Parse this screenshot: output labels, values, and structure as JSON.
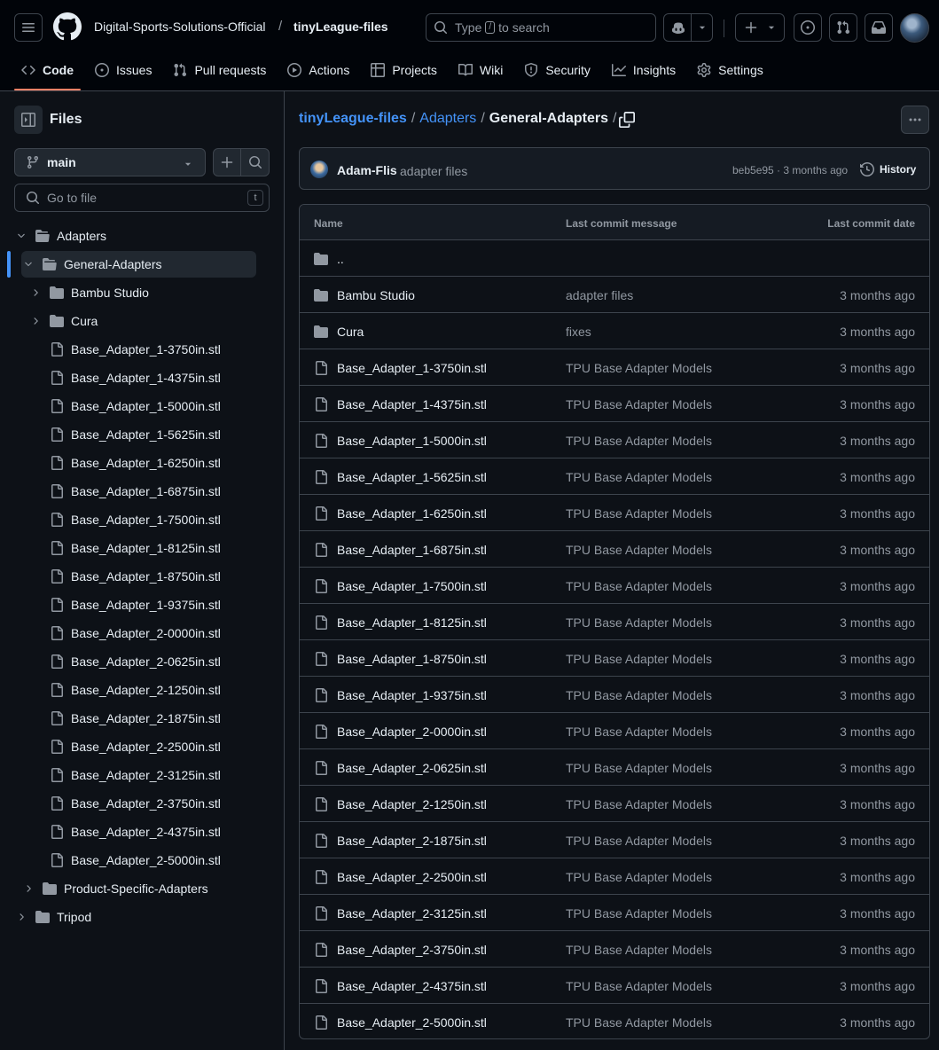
{
  "header": {
    "owner": "Digital-Sports-Solutions-Official",
    "separator": "/",
    "repo": "tinyLeague-files",
    "search_prefix": "Type",
    "search_key": "/",
    "search_suffix": "to search"
  },
  "tabs": [
    {
      "label": "Code",
      "icon": "code-icon",
      "active": true
    },
    {
      "label": "Issues",
      "icon": "issue-icon"
    },
    {
      "label": "Pull requests",
      "icon": "pull-request-icon"
    },
    {
      "label": "Actions",
      "icon": "play-icon"
    },
    {
      "label": "Projects",
      "icon": "table-icon"
    },
    {
      "label": "Wiki",
      "icon": "book-icon"
    },
    {
      "label": "Security",
      "icon": "shield-icon"
    },
    {
      "label": "Insights",
      "icon": "graph-icon"
    },
    {
      "label": "Settings",
      "icon": "gear-icon"
    }
  ],
  "sidebar": {
    "title": "Files",
    "branch": "main",
    "go_to_file": "Go to file",
    "go_to_file_key": "t",
    "tree": [
      {
        "label": "Adapters",
        "type": "folder",
        "level": 0,
        "expanded": true
      },
      {
        "label": "General-Adapters",
        "type": "folder",
        "level": 1,
        "expanded": true,
        "selected": true
      },
      {
        "label": "Bambu Studio",
        "type": "folder",
        "level": 2,
        "expanded": false
      },
      {
        "label": "Cura",
        "type": "folder",
        "level": 2,
        "expanded": false
      },
      {
        "label": "Base_Adapter_1-3750in.stl",
        "type": "file",
        "level": 2
      },
      {
        "label": "Base_Adapter_1-4375in.stl",
        "type": "file",
        "level": 2
      },
      {
        "label": "Base_Adapter_1-5000in.stl",
        "type": "file",
        "level": 2
      },
      {
        "label": "Base_Adapter_1-5625in.stl",
        "type": "file",
        "level": 2
      },
      {
        "label": "Base_Adapter_1-6250in.stl",
        "type": "file",
        "level": 2
      },
      {
        "label": "Base_Adapter_1-6875in.stl",
        "type": "file",
        "level": 2
      },
      {
        "label": "Base_Adapter_1-7500in.stl",
        "type": "file",
        "level": 2
      },
      {
        "label": "Base_Adapter_1-8125in.stl",
        "type": "file",
        "level": 2
      },
      {
        "label": "Base_Adapter_1-8750in.stl",
        "type": "file",
        "level": 2
      },
      {
        "label": "Base_Adapter_1-9375in.stl",
        "type": "file",
        "level": 2
      },
      {
        "label": "Base_Adapter_2-0000in.stl",
        "type": "file",
        "level": 2
      },
      {
        "label": "Base_Adapter_2-0625in.stl",
        "type": "file",
        "level": 2
      },
      {
        "label": "Base_Adapter_2-1250in.stl",
        "type": "file",
        "level": 2
      },
      {
        "label": "Base_Adapter_2-1875in.stl",
        "type": "file",
        "level": 2
      },
      {
        "label": "Base_Adapter_2-2500in.stl",
        "type": "file",
        "level": 2
      },
      {
        "label": "Base_Adapter_2-3125in.stl",
        "type": "file",
        "level": 2
      },
      {
        "label": "Base_Adapter_2-3750in.stl",
        "type": "file",
        "level": 2
      },
      {
        "label": "Base_Adapter_2-4375in.stl",
        "type": "file",
        "level": 2
      },
      {
        "label": "Base_Adapter_2-5000in.stl",
        "type": "file",
        "level": 2
      },
      {
        "label": "Product-Specific-Adapters",
        "type": "folder",
        "level": 1,
        "expanded": false
      },
      {
        "label": "Tripod",
        "type": "folder",
        "level": 0,
        "expanded": false
      }
    ]
  },
  "breadcrumb": {
    "root": "tinyLeague-files",
    "parent": "Adapters",
    "current": "General-Adapters",
    "sep": "/"
  },
  "commit": {
    "author": "Adam-Flis",
    "message": "adapter files",
    "meta": "beb5e95 · 3 months ago",
    "history": "History"
  },
  "table": {
    "headers": {
      "name": "Name",
      "message": "Last commit message",
      "date": "Last commit date"
    },
    "parent_row": "..",
    "rows": [
      {
        "name": "Bambu Studio",
        "type": "folder",
        "message": "adapter files",
        "date": "3 months ago"
      },
      {
        "name": "Cura",
        "type": "folder",
        "message": "fixes",
        "date": "3 months ago"
      },
      {
        "name": "Base_Adapter_1-3750in.stl",
        "type": "file",
        "message": "TPU Base Adapter Models",
        "date": "3 months ago"
      },
      {
        "name": "Base_Adapter_1-4375in.stl",
        "type": "file",
        "message": "TPU Base Adapter Models",
        "date": "3 months ago"
      },
      {
        "name": "Base_Adapter_1-5000in.stl",
        "type": "file",
        "message": "TPU Base Adapter Models",
        "date": "3 months ago"
      },
      {
        "name": "Base_Adapter_1-5625in.stl",
        "type": "file",
        "message": "TPU Base Adapter Models",
        "date": "3 months ago"
      },
      {
        "name": "Base_Adapter_1-6250in.stl",
        "type": "file",
        "message": "TPU Base Adapter Models",
        "date": "3 months ago"
      },
      {
        "name": "Base_Adapter_1-6875in.stl",
        "type": "file",
        "message": "TPU Base Adapter Models",
        "date": "3 months ago"
      },
      {
        "name": "Base_Adapter_1-7500in.stl",
        "type": "file",
        "message": "TPU Base Adapter Models",
        "date": "3 months ago"
      },
      {
        "name": "Base_Adapter_1-8125in.stl",
        "type": "file",
        "message": "TPU Base Adapter Models",
        "date": "3 months ago"
      },
      {
        "name": "Base_Adapter_1-8750in.stl",
        "type": "file",
        "message": "TPU Base Adapter Models",
        "date": "3 months ago"
      },
      {
        "name": "Base_Adapter_1-9375in.stl",
        "type": "file",
        "message": "TPU Base Adapter Models",
        "date": "3 months ago"
      },
      {
        "name": "Base_Adapter_2-0000in.stl",
        "type": "file",
        "message": "TPU Base Adapter Models",
        "date": "3 months ago"
      },
      {
        "name": "Base_Adapter_2-0625in.stl",
        "type": "file",
        "message": "TPU Base Adapter Models",
        "date": "3 months ago"
      },
      {
        "name": "Base_Adapter_2-1250in.stl",
        "type": "file",
        "message": "TPU Base Adapter Models",
        "date": "3 months ago"
      },
      {
        "name": "Base_Adapter_2-1875in.stl",
        "type": "file",
        "message": "TPU Base Adapter Models",
        "date": "3 months ago"
      },
      {
        "name": "Base_Adapter_2-2500in.stl",
        "type": "file",
        "message": "TPU Base Adapter Models",
        "date": "3 months ago"
      },
      {
        "name": "Base_Adapter_2-3125in.stl",
        "type": "file",
        "message": "TPU Base Adapter Models",
        "date": "3 months ago"
      },
      {
        "name": "Base_Adapter_2-3750in.stl",
        "type": "file",
        "message": "TPU Base Adapter Models",
        "date": "3 months ago"
      },
      {
        "name": "Base_Adapter_2-4375in.stl",
        "type": "file",
        "message": "TPU Base Adapter Models",
        "date": "3 months ago"
      },
      {
        "name": "Base_Adapter_2-5000in.stl",
        "type": "file",
        "message": "TPU Base Adapter Models",
        "date": "3 months ago"
      }
    ]
  },
  "colors": {
    "bg": "#0d1117",
    "header_bg": "#010409",
    "border": "#3d444d",
    "link": "#4493f8",
    "muted": "#9198a1",
    "accent_underline": "#f78166"
  }
}
